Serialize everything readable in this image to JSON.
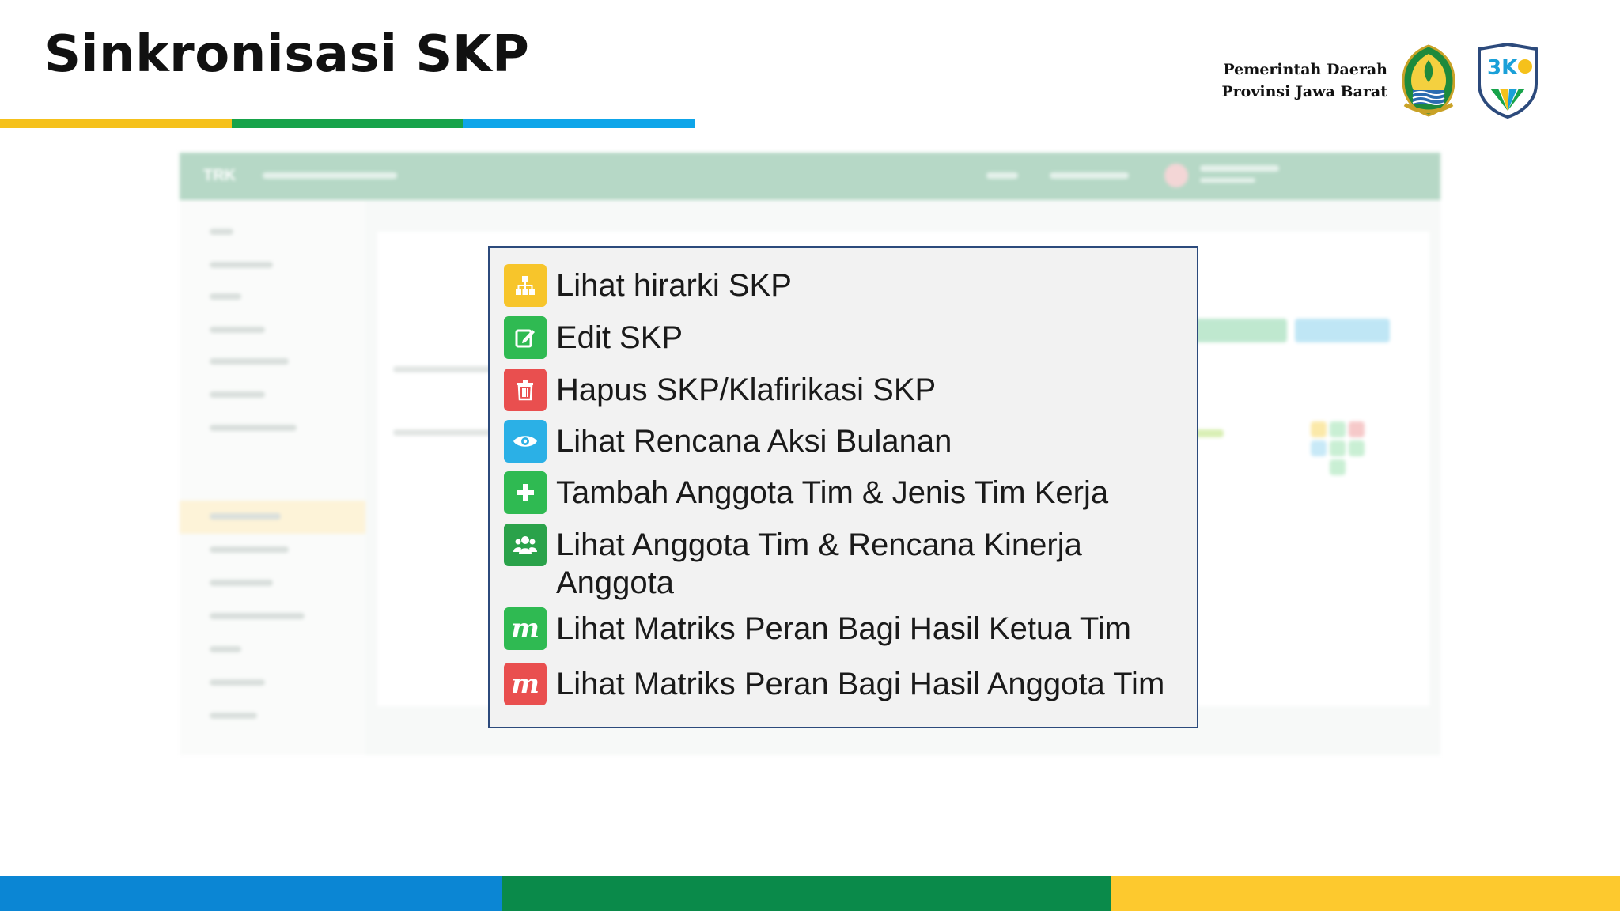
{
  "slide": {
    "title": "Sinkronisasi SKP",
    "title_bar_colors": [
      "#f5c11b",
      "#17a34a",
      "#0ea5e9"
    ],
    "footer_colors": [
      "#0b86d4",
      "#0a8a4a",
      "#fdc92e"
    ]
  },
  "header": {
    "org_line1": "Pemerintah Daerah",
    "org_line2": "Provinsi Jawa Barat",
    "logos": [
      "jawa-barat-crest",
      "bkd-logo"
    ]
  },
  "app_screenshot": {
    "brand": "TRK"
  },
  "legend": {
    "items": [
      {
        "label": "Lihat hirarki SKP",
        "icon": "hierarchy-icon",
        "color": "#f7c52b"
      },
      {
        "label": "Edit SKP",
        "icon": "edit-icon",
        "color": "#2fba52"
      },
      {
        "label": "Hapus SKP/Klafirikasi SKP",
        "icon": "trash-icon",
        "color": "#e94f4f"
      },
      {
        "label": "Lihat Rencana Aksi Bulanan",
        "icon": "eye-icon",
        "color": "#2bb0e6"
      },
      {
        "label": "Tambah Anggota Tim & Jenis Tim Kerja",
        "icon": "plus-icon",
        "color": "#2fba52"
      },
      {
        "label": "Lihat Anggota Tim & Rencana Kinerja Anggota",
        "icon": "users-icon",
        "color": "#2aa24a"
      },
      {
        "label": "Lihat Matriks Peran Bagi Hasil Ketua Tim",
        "icon": "matrix-icon",
        "color": "#2fba52",
        "glyph": "m"
      },
      {
        "label": "Lihat Matriks Peran Bagi Hasil Anggota Tim",
        "icon": "matrix-icon",
        "color": "#e94f4f",
        "glyph": "m"
      }
    ]
  }
}
